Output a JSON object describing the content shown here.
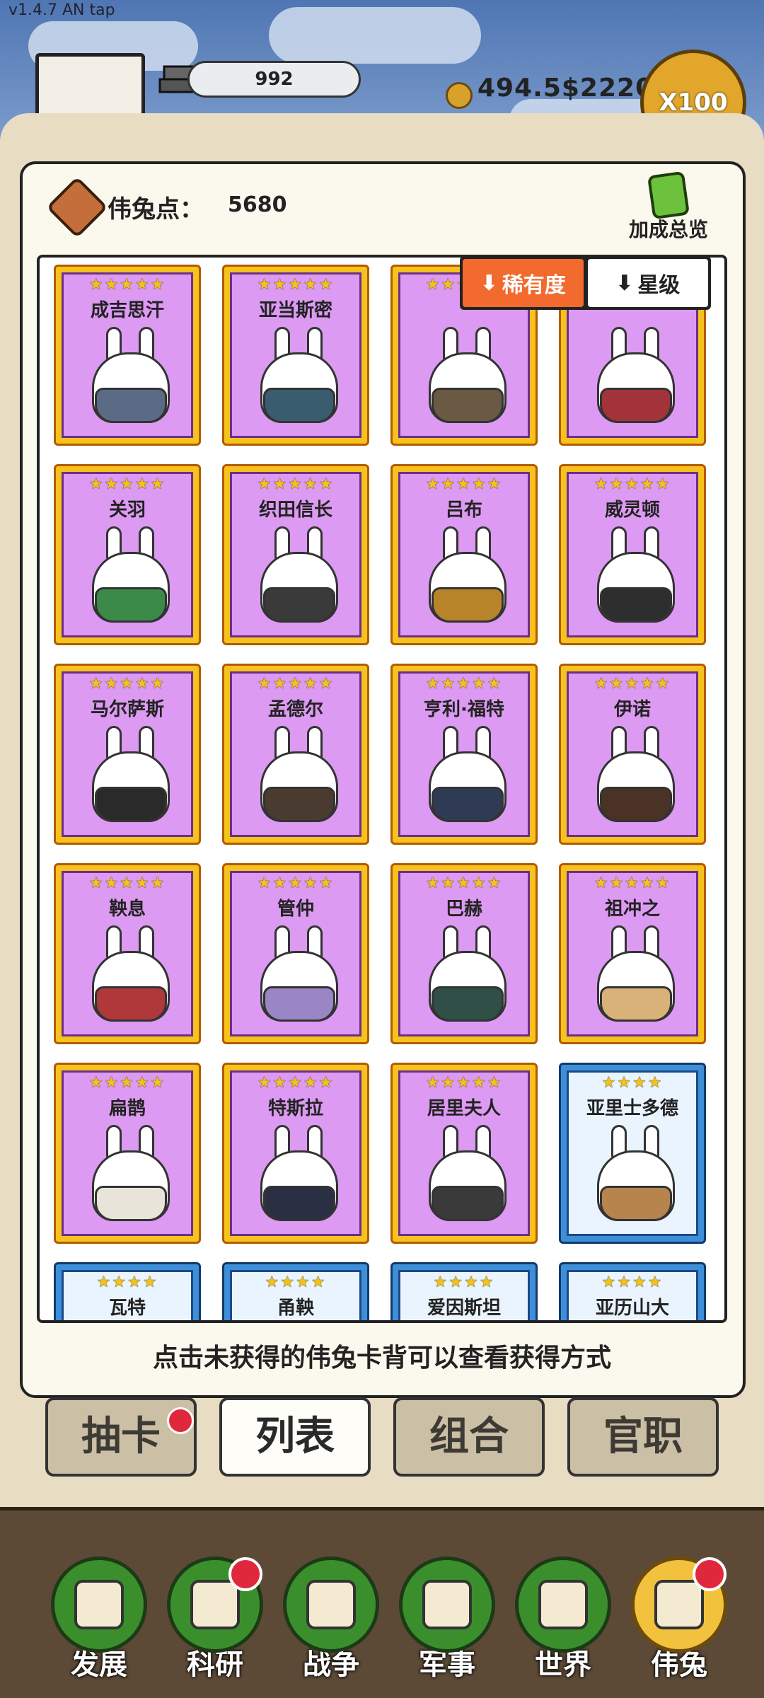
{
  "version": "v1.4.7 AN tap",
  "top": {
    "bricks": "992",
    "money": "494.5$2220",
    "multiplier": "X100"
  },
  "header": {
    "points_label": "伟兔点：",
    "points_value": "5680",
    "bonus_label": "加成总览"
  },
  "sort": {
    "rarity": "稀有度",
    "star": "星级"
  },
  "cards": [
    {
      "name": "成吉思汗",
      "stars": "★★★★★",
      "tier": "gold",
      "cloth": "#5b6b85"
    },
    {
      "name": "亚当斯密",
      "stars": "★★★★★",
      "tier": "gold",
      "cloth": "#395d6f"
    },
    {
      "name": "",
      "stars": "★★★★★",
      "tier": "gold",
      "cloth": "#6a5a44"
    },
    {
      "name": "",
      "stars": "★★★★★",
      "tier": "gold",
      "cloth": "#a3333a"
    },
    {
      "name": "关羽",
      "stars": "★★★★★",
      "tier": "gold",
      "cloth": "#3c8a4a"
    },
    {
      "name": "织田信长",
      "stars": "★★★★★",
      "tier": "gold",
      "cloth": "#3a3a3a"
    },
    {
      "name": "吕布",
      "stars": "★★★★★",
      "tier": "gold",
      "cloth": "#b8842a"
    },
    {
      "name": "威灵顿",
      "stars": "★★★★★",
      "tier": "gold",
      "cloth": "#2e2e2e"
    },
    {
      "name": "马尔萨斯",
      "stars": "★★★★★",
      "tier": "gold",
      "cloth": "#2a2a2a"
    },
    {
      "name": "孟德尔",
      "stars": "★★★★★",
      "tier": "gold",
      "cloth": "#4a3b31"
    },
    {
      "name": "亨利·福特",
      "stars": "★★★★★",
      "tier": "gold",
      "cloth": "#2f3b55"
    },
    {
      "name": "伊诺",
      "stars": "★★★★★",
      "tier": "gold",
      "cloth": "#4a3325"
    },
    {
      "name": "鞅息",
      "stars": "★★★★★",
      "tier": "gold",
      "cloth": "#b0383a"
    },
    {
      "name": "管仲",
      "stars": "★★★★★",
      "tier": "gold",
      "cloth": "#9a86c4"
    },
    {
      "name": "巴赫",
      "stars": "★★★★★",
      "tier": "gold",
      "cloth": "#2f4f47"
    },
    {
      "name": "祖冲之",
      "stars": "★★★★★",
      "tier": "gold",
      "cloth": "#d9b27a"
    },
    {
      "name": "扁鹊",
      "stars": "★★★★★",
      "tier": "gold",
      "cloth": "#e8e4da"
    },
    {
      "name": "特斯拉",
      "stars": "★★★★★",
      "tier": "gold",
      "cloth": "#2b2f44"
    },
    {
      "name": "居里夫人",
      "stars": "★★★★★",
      "tier": "gold",
      "cloth": "#3a3a3a"
    },
    {
      "name": "亚里士多德",
      "stars": "★★★★",
      "tier": "blue",
      "cloth": "#b8844e"
    },
    {
      "name": "瓦特",
      "stars": "★★★★",
      "tier": "blue",
      "cloth": "#f0f0f0"
    },
    {
      "name": "甬鞅",
      "stars": "★★★★",
      "tier": "blue",
      "cloth": "#f0f0f0"
    },
    {
      "name": "爱因斯坦",
      "stars": "★★★★",
      "tier": "blue",
      "cloth": "#f0f0f0"
    },
    {
      "name": "亚历山大",
      "stars": "★★★★",
      "tier": "blue",
      "cloth": "#f0f0f0"
    }
  ],
  "hint": "点击未获得的伟兔卡背可以查看获得方式",
  "tabs": [
    {
      "label": "抽卡",
      "dot": true
    },
    {
      "label": "列表",
      "dot": false
    },
    {
      "label": "组合",
      "dot": false
    },
    {
      "label": "官职",
      "dot": false
    }
  ],
  "nav": [
    {
      "label": "发展",
      "dot": false,
      "icon": "growth-arrow-icon"
    },
    {
      "label": "科研",
      "dot": true,
      "icon": "flask-icon"
    },
    {
      "label": "战争",
      "dot": false,
      "icon": "crossed-swords-icon"
    },
    {
      "label": "军事",
      "dot": false,
      "icon": "helmet-icon"
    },
    {
      "label": "世界",
      "dot": false,
      "icon": "globe-icon"
    },
    {
      "label": "伟兔",
      "dot": true,
      "icon": "rabbit-card-icon"
    }
  ]
}
